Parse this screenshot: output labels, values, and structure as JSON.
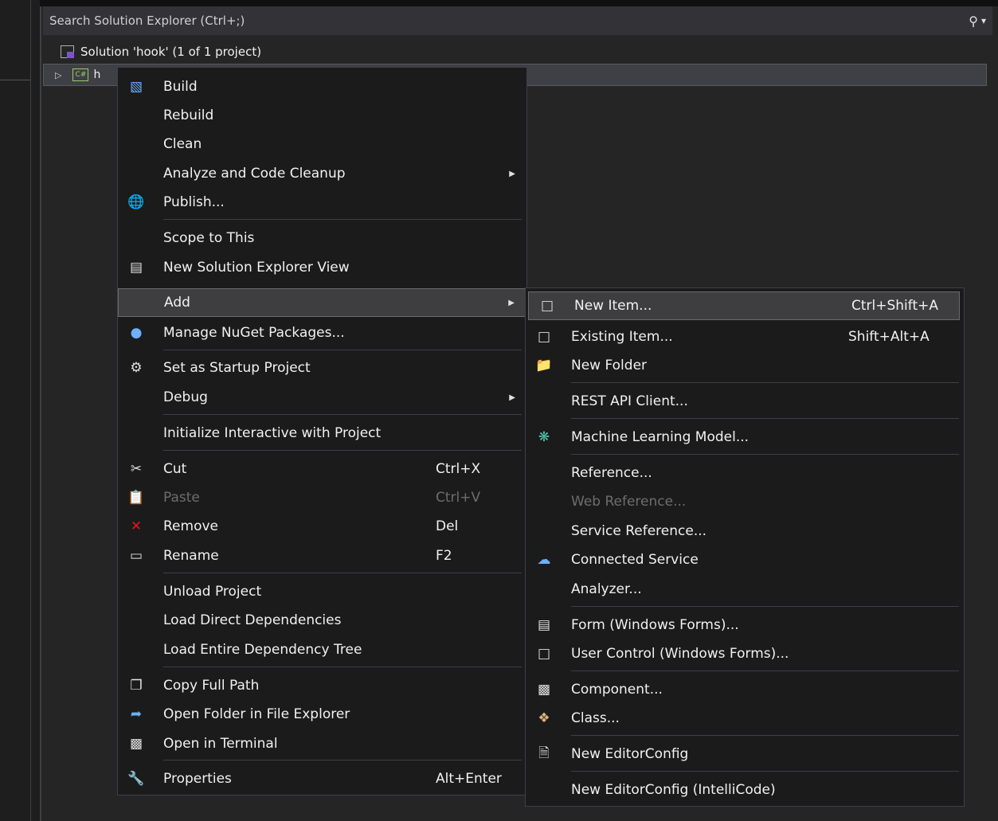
{
  "search": {
    "placeholder": "Search Solution Explorer (Ctrl+;)",
    "icon": "search-icon"
  },
  "tree": {
    "solution_label": "Solution 'hook' (1 of 1 project)",
    "project_label": "h"
  },
  "context_menu": {
    "build": "Build",
    "rebuild": "Rebuild",
    "clean": "Clean",
    "analyze": "Analyze and Code Cleanup",
    "publish": "Publish...",
    "scope": "Scope to This",
    "new_view": "New Solution Explorer View",
    "add": "Add",
    "nuget": "Manage NuGet Packages...",
    "startup": "Set as Startup Project",
    "debug": "Debug",
    "interactive": "Initialize Interactive with Project",
    "cut": "Cut",
    "cut_sc": "Ctrl+X",
    "paste": "Paste",
    "paste_sc": "Ctrl+V",
    "remove": "Remove",
    "remove_sc": "Del",
    "rename": "Rename",
    "rename_sc": "F2",
    "unload": "Unload Project",
    "load_direct": "Load Direct Dependencies",
    "load_tree": "Load Entire Dependency Tree",
    "copy_path": "Copy Full Path",
    "open_folder": "Open Folder in File Explorer",
    "open_terminal": "Open in Terminal",
    "properties": "Properties",
    "properties_sc": "Alt+Enter"
  },
  "add_submenu": {
    "new_item": "New Item...",
    "new_item_sc": "Ctrl+Shift+A",
    "existing_item": "Existing Item...",
    "existing_item_sc": "Shift+Alt+A",
    "new_folder": "New Folder",
    "rest_api": "REST API Client...",
    "ml_model": "Machine Learning Model...",
    "reference": "Reference...",
    "web_reference": "Web Reference...",
    "service_reference": "Service Reference...",
    "connected_service": "Connected Service",
    "analyzer": "Analyzer...",
    "form": "Form (Windows Forms)...",
    "user_control": "User Control (Windows Forms)...",
    "component": "Component...",
    "class": "Class...",
    "editorconfig": "New EditorConfig",
    "editorconfig_ic": "New EditorConfig (IntelliCode)"
  },
  "colors": {
    "menu_bg": "#1b1b1c",
    "highlight": "#3e3e40",
    "remove_icon": "#e81123",
    "accent_blue": "#3794ff"
  }
}
